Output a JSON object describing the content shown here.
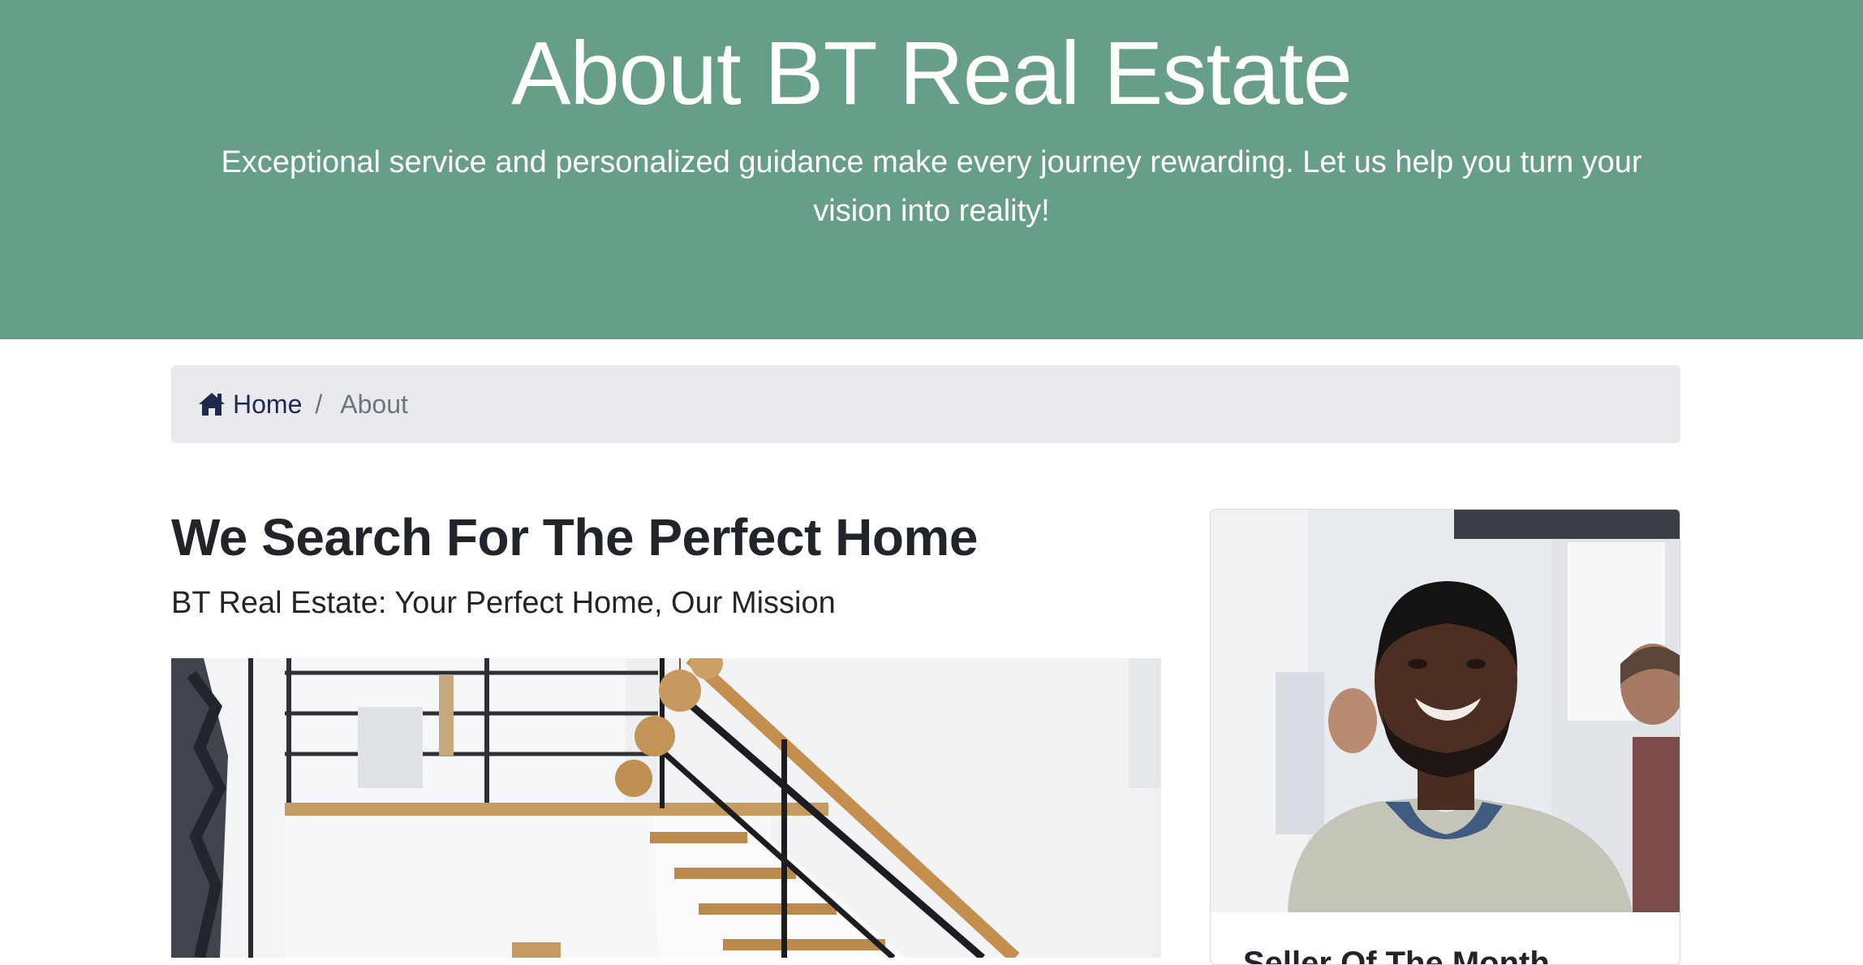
{
  "hero": {
    "title": "About BT Real Estate",
    "subtitle": "Exceptional service and personalized guidance make every journey rewarding. Let us help you turn your vision into reality!"
  },
  "breadcrumb": {
    "home_label": "Home",
    "separator": "/",
    "current": "About"
  },
  "main": {
    "title": "We Search For The Perfect Home",
    "subtitle": "BT Real Estate: Your Perfect Home, Our Mission"
  },
  "seller_card": {
    "title": "Seller Of The Month"
  },
  "icons": {
    "breadcrumb_home": "home-icon"
  },
  "colors": {
    "hero_background": "#679e87",
    "breadcrumb_background": "#e9eaee",
    "link": "#1d2a4d"
  }
}
